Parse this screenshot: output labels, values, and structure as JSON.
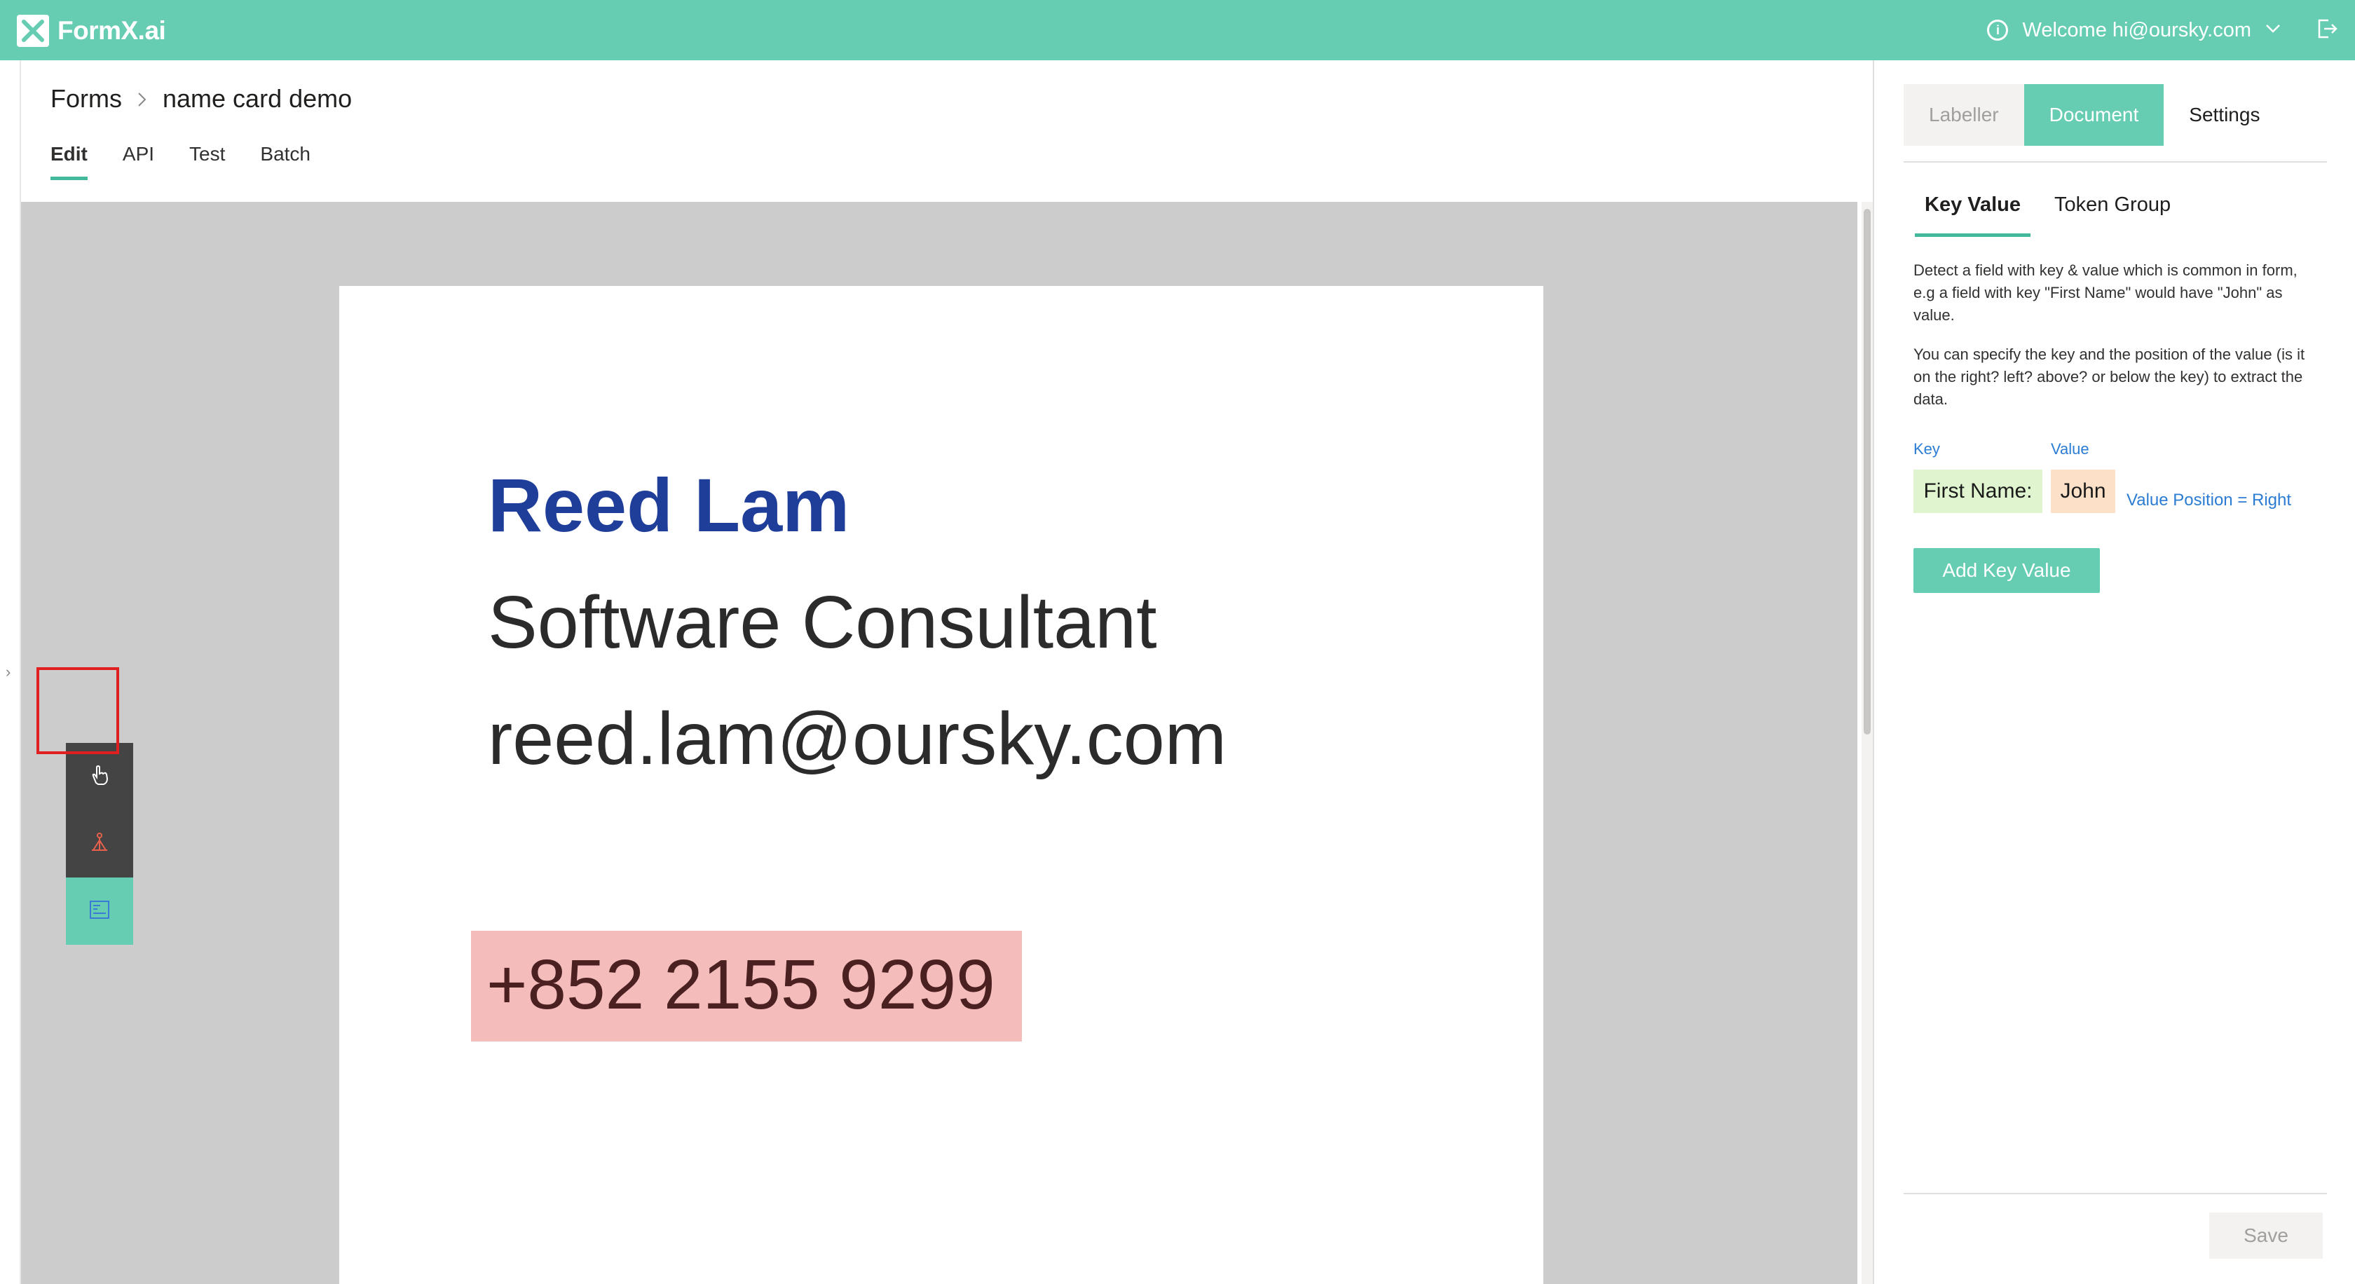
{
  "app": {
    "logo_text": "FormX.ai",
    "welcome_text": "Welcome hi@oursky.com",
    "accent_color": "#66cdb3"
  },
  "breadcrumb": {
    "root": "Forms",
    "current": "name card demo"
  },
  "main_tabs": [
    {
      "label": "Edit",
      "active": true
    },
    {
      "label": "API",
      "active": false
    },
    {
      "label": "Test",
      "active": false
    },
    {
      "label": "Batch",
      "active": false
    }
  ],
  "document": {
    "name": "Reed Lam",
    "title": "Software Consultant",
    "email": "reed.lam@oursky.com",
    "phone": "+852 2155 9299"
  },
  "tools": [
    {
      "icon": "pointer-hand-icon",
      "active": false
    },
    {
      "icon": "anchor-icon",
      "active": false
    },
    {
      "icon": "detection-region-icon",
      "active": true
    }
  ],
  "panel": {
    "tabs": [
      "Labeller",
      "Document",
      "Settings"
    ],
    "active_tab": "Document",
    "sub_tabs": [
      "Key Value",
      "Token Group"
    ],
    "active_sub_tab": "Key Value",
    "description_1": "Detect a field with key & value which is common in form, e.g a field with key \"First Name\" would have \"John\" as value.",
    "description_2": "You can specify the key and the position of the value (is it on the right? left? above? or below the key) to extract the data.",
    "example": {
      "key_label": "Key",
      "value_label": "Value",
      "key_text": "First Name:",
      "value_text": "John",
      "position_text": "Value Position = Right"
    },
    "add_button": "Add Key Value",
    "save_button": "Save"
  }
}
